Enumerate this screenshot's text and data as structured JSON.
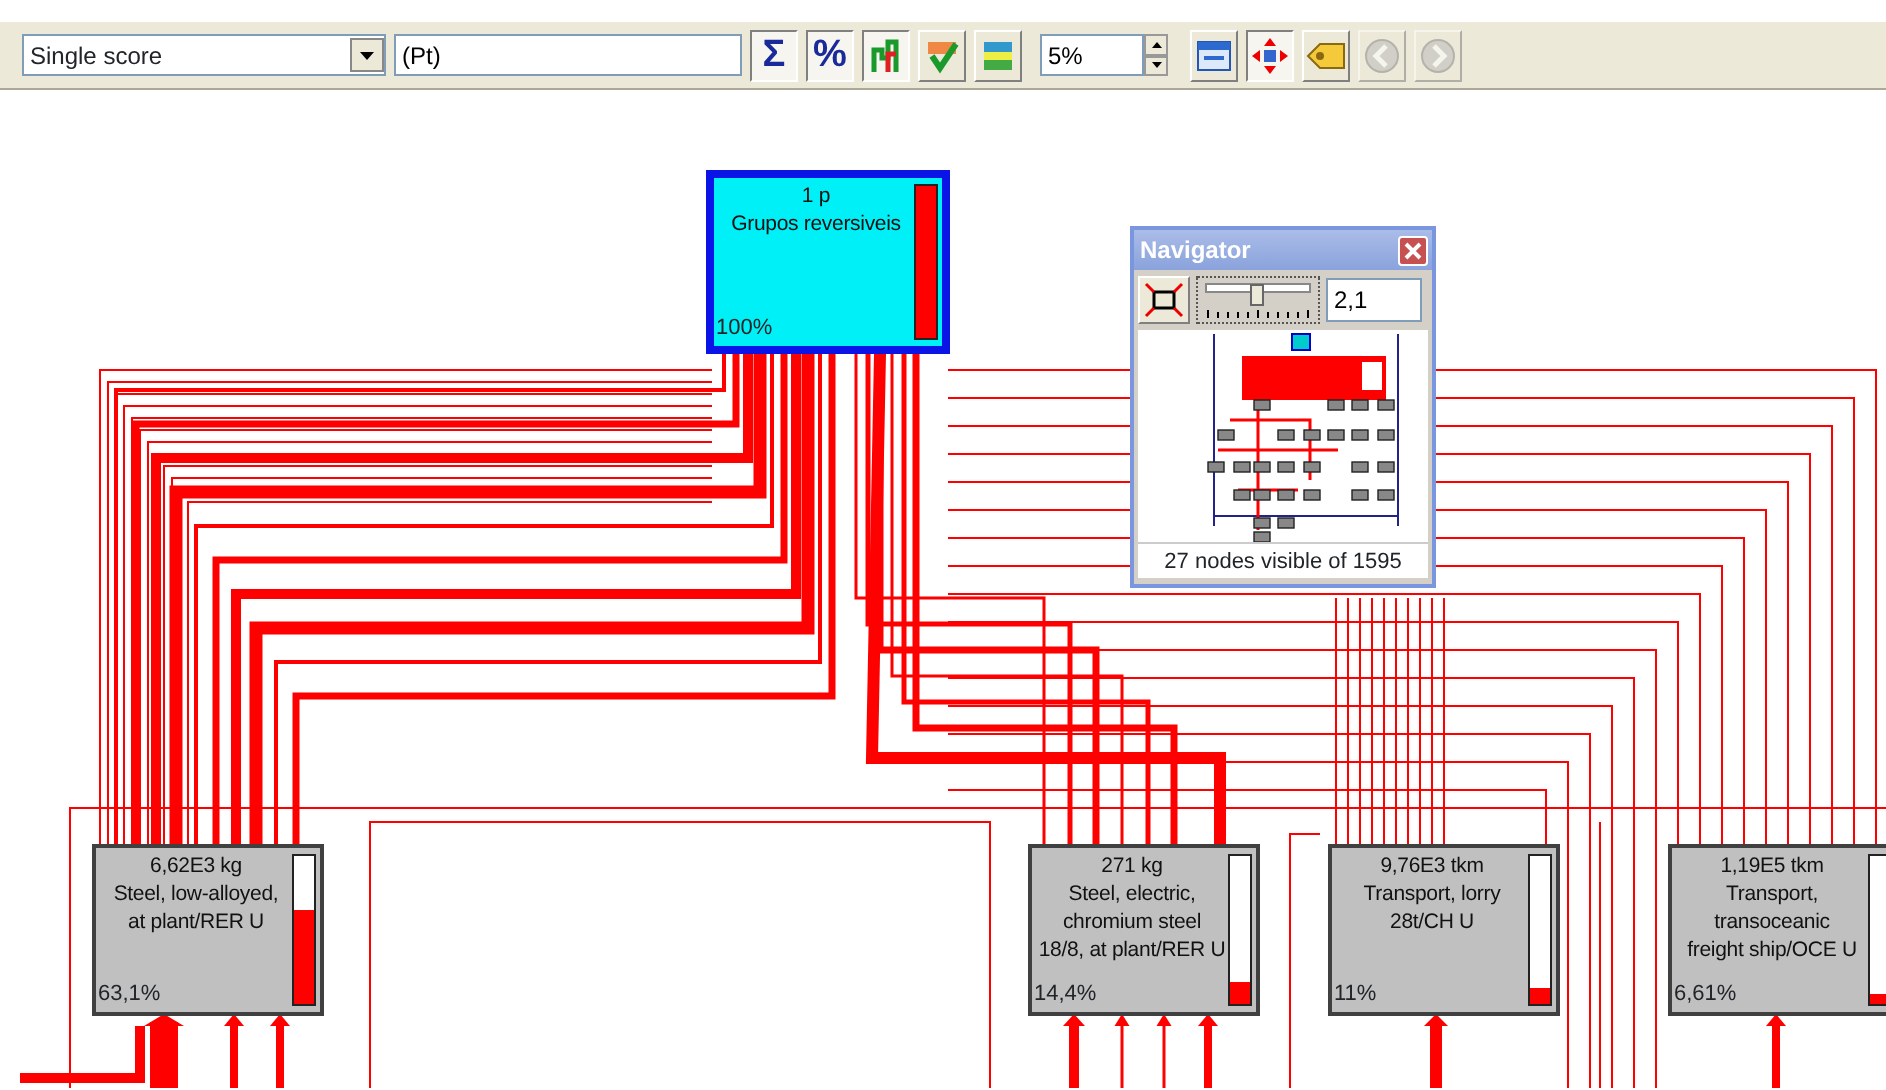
{
  "toolbar": {
    "method_select": {
      "value": "Single score"
    },
    "unit_field": {
      "value": "(Pt)"
    },
    "buttons": [
      {
        "kind": "text",
        "label": "Σ",
        "pressed": true,
        "disabled": false
      },
      {
        "kind": "text",
        "label": "%",
        "pressed": true,
        "disabled": false
      },
      {
        "kind": "icon",
        "pressed": true,
        "disabled": false
      },
      {
        "kind": "icon",
        "pressed": false,
        "disabled": false
      },
      {
        "kind": "icon",
        "pressed": false,
        "disabled": false
      }
    ],
    "cutoff_field": {
      "value": "5%"
    },
    "buttons_2": [
      {
        "kind": "icon",
        "pressed": false,
        "disabled": false
      },
      {
        "kind": "icon",
        "pressed": true,
        "disabled": false
      },
      {
        "kind": "icon",
        "pressed": false,
        "disabled": false
      },
      {
        "kind": "icon",
        "pressed": false,
        "disabled": true
      },
      {
        "kind": "icon",
        "pressed": false,
        "disabled": true
      }
    ]
  },
  "nodes": [
    {
      "amount": "1 p",
      "name": "Grupos reversiveis",
      "share": "100%",
      "level": 1,
      "selected": true
    },
    {
      "amount": "6,62E3 kg",
      "name": "Steel, low-alloyed,\nat plant/RER U",
      "share": "63,1%",
      "level": 0.631,
      "selected": false
    },
    {
      "amount": "271 kg",
      "name": "Steel, electric,\nchromium steel\n18/8, at plant/RER U",
      "share": "14,4%",
      "level": 0.144,
      "selected": false
    },
    {
      "amount": "9,76E3 tkm",
      "name": "Transport, lorry\n28t/CH U",
      "share": "11%",
      "level": 0.11,
      "selected": false
    },
    {
      "amount": "1,19E5 tkm",
      "name": "Transport,\ntransoceanic\nfreight ship/OCE U",
      "share": "6,61%",
      "level": 0.0661,
      "selected": false
    }
  ],
  "navigator": {
    "title": "Navigator",
    "zoom_slider": {
      "level": 0.45
    },
    "zoom_field": {
      "value": "2,1"
    },
    "status": "27 nodes visible of 1595"
  }
}
